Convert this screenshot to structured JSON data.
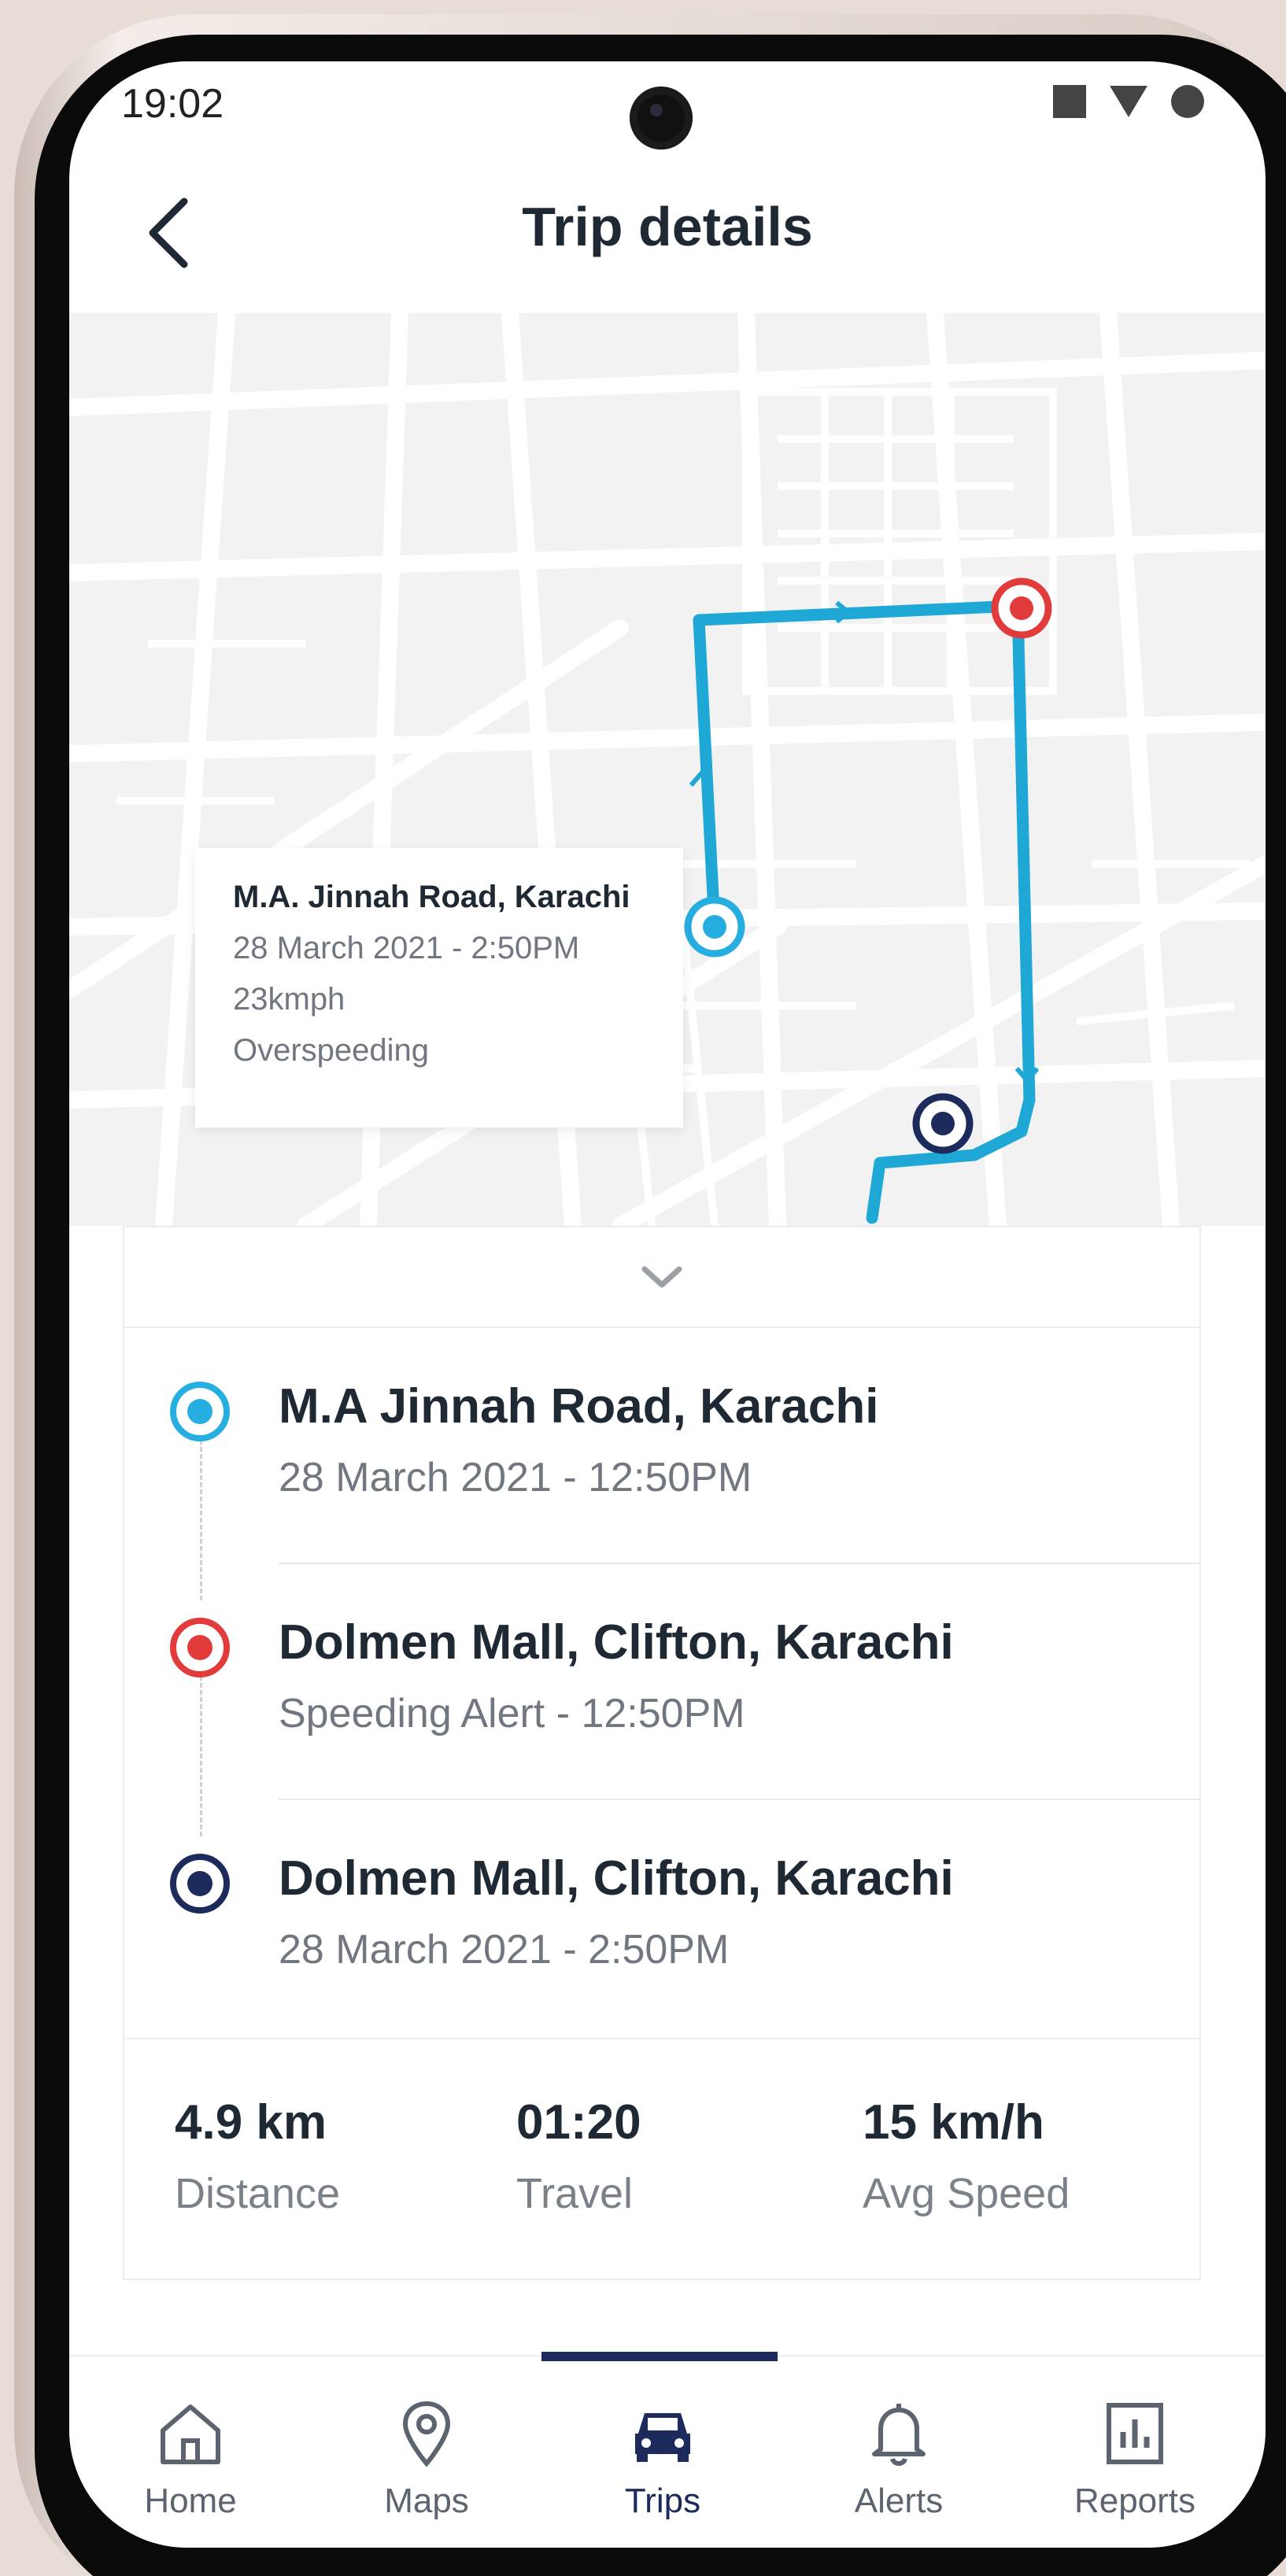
{
  "status_bar": {
    "time": "19:02"
  },
  "header": {
    "title": "Trip details"
  },
  "map_tooltip": {
    "location": "M.A. Jinnah Road, Karachi",
    "datetime": "28 March 2021 - 2:50PM",
    "speed": "23kmph",
    "event": "Overspeeding"
  },
  "trip_stops": [
    {
      "title": "M.A Jinnah Road, Karachi",
      "subtitle": "28 March 2021 - 12:50PM",
      "color": "#26aee0"
    },
    {
      "title": "Dolmen Mall, Clifton, Karachi",
      "subtitle": "Speeding Alert - 12:50PM",
      "color": "#e23b3b"
    },
    {
      "title": "Dolmen Mall, Clifton, Karachi",
      "subtitle": "28 March 2021 - 2:50PM",
      "color": "#1c2a5c"
    }
  ],
  "stats": [
    {
      "value": "4.9 km",
      "label": "Distance"
    },
    {
      "value": "01:20",
      "label": "Travel"
    },
    {
      "value": "15 km/h",
      "label": "Avg Speed"
    }
  ],
  "bottom_nav": [
    {
      "label": "Home",
      "icon": "home-icon"
    },
    {
      "label": "Maps",
      "icon": "map-pin-icon"
    },
    {
      "label": "Trips",
      "icon": "car-icon",
      "active": true
    },
    {
      "label": "Alerts",
      "icon": "bell-icon"
    },
    {
      "label": "Reports",
      "icon": "report-chart-icon"
    }
  ],
  "colors": {
    "route": "#1fa8d6",
    "accent_navy": "#1c2a5c",
    "alert_red": "#e23b3b"
  }
}
